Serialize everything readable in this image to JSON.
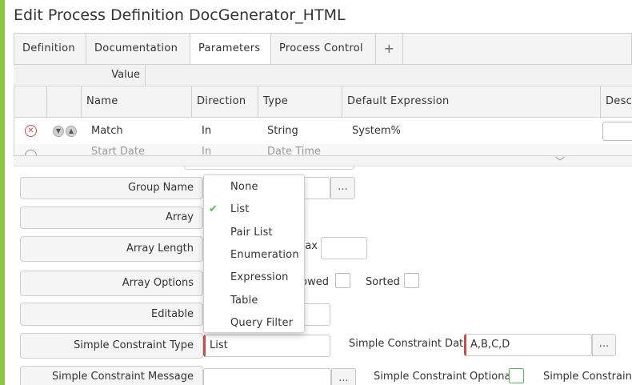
{
  "window": {
    "title": "Edit Process Definition DocGenerator_HTML"
  },
  "colors": {
    "accent": "#8dc63f",
    "required": "#c0504d",
    "check": "#5cb85c"
  },
  "tabs": [
    "Definition",
    "Documentation",
    "Parameters",
    "Process Control"
  ],
  "tab_add_label": "+",
  "value_row": {
    "label": "Value"
  },
  "grid": {
    "columns": [
      "Name",
      "Direction",
      "Type",
      "Default Expression",
      "Desc"
    ],
    "rows": [
      {
        "name": "Match",
        "direction": "In",
        "type": "String",
        "default_expression": "System%"
      }
    ],
    "partial_row": {
      "name": "Start Date",
      "direction": "In",
      "type": "Date Time"
    }
  },
  "form": {
    "group_name_label": "Group Name",
    "array_label": "Array",
    "array_length_label": "Array Length",
    "max_label": "Max",
    "array_options_label": "Array Options",
    "allowed_label": "Allowed",
    "sorted_label": "Sorted",
    "editable_label": "Editable",
    "simple_constraint_type_label": "Simple Constraint Type",
    "simple_constraint_type_value": "List",
    "simple_constraint_data_label": "Simple Constraint Data",
    "simple_constraint_data_value": "A,B,C,D",
    "simple_constraint_message_label": "Simple Constraint Message",
    "simple_constraint_optional_label": "Simple Constraint Optional",
    "simple_constraint_trailing_label": "Simple Constraint V",
    "ellipsis": "..."
  },
  "dropdown": {
    "selected": "List",
    "options": [
      "None",
      "List",
      "Pair List",
      "Enumeration",
      "Expression",
      "Table",
      "Query Filter"
    ]
  },
  "icons": {
    "remove": "remove-circle-icon",
    "move_down": "move-down-icon",
    "move_up": "move-up-icon",
    "splitter": "chevron-down-icon",
    "check": "checkmark-icon"
  }
}
